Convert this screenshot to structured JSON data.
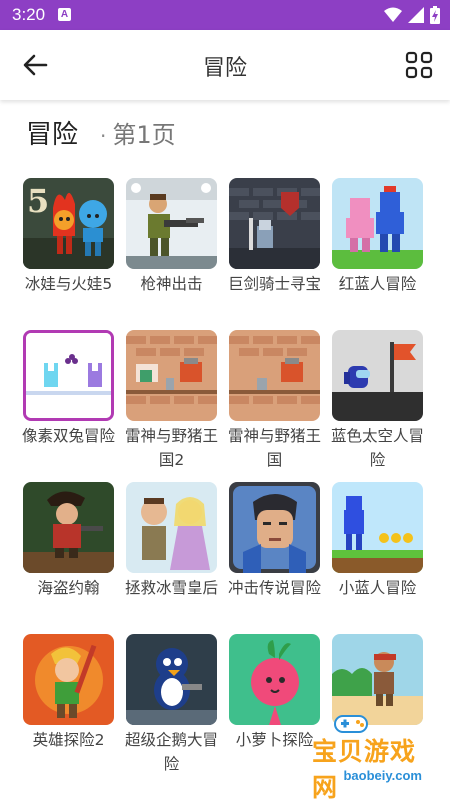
{
  "status_bar": {
    "time": "3:20",
    "notification_glyph": "A"
  },
  "app_bar": {
    "title": "冒险"
  },
  "section": {
    "title": "冒险",
    "separator": "·",
    "page": "第1页"
  },
  "games": [
    {
      "name": "冰娃与火娃5",
      "thumb": "fire-water-5"
    },
    {
      "name": "枪神出击",
      "thumb": "gun-soldier"
    },
    {
      "name": "巨剑骑士寻宝",
      "thumb": "knight-castle"
    },
    {
      "name": "红蓝人冒险",
      "thumb": "red-blue-men"
    },
    {
      "name": "像素双兔冒险",
      "thumb": "pixel-rabbits"
    },
    {
      "name": "雷神与野猪王国2",
      "thumb": "thor-boar-2"
    },
    {
      "name": "雷神与野猪王国",
      "thumb": "thor-boar"
    },
    {
      "name": "蓝色太空人冒险",
      "thumb": "blue-astronaut"
    },
    {
      "name": "海盗约翰",
      "thumb": "pirate-john"
    },
    {
      "name": "拯救冰雪皇后",
      "thumb": "ice-queen"
    },
    {
      "name": "冲击传说冒险",
      "thumb": "legend-hero"
    },
    {
      "name": "小蓝人冒险",
      "thumb": "little-blue-man"
    },
    {
      "name": "英雄探险2",
      "thumb": "hero-explore-2"
    },
    {
      "name": "超级企鹅大冒险",
      "thumb": "super-penguin"
    },
    {
      "name": "小萝卜探险",
      "thumb": "radish"
    },
    {
      "name": "",
      "thumb": "jungle-warrior"
    }
  ],
  "watermark": {
    "text": "宝贝游戏网",
    "url": "baobeiy.com"
  },
  "colors": {
    "status_bar": "#8d3fc4",
    "watermark_orange": "#f7a31c",
    "watermark_blue": "#2a8fd8"
  }
}
